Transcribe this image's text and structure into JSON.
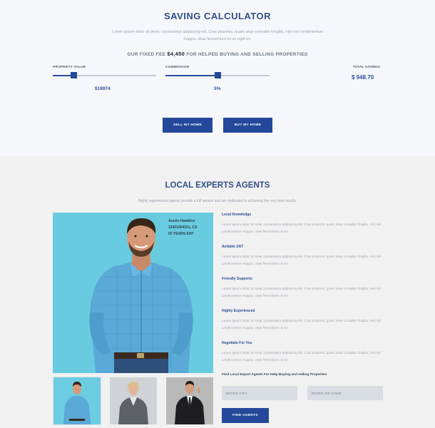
{
  "calculator": {
    "title": "SAVING CALCULATOR",
    "description": "Lorem ipsum dolor sit amet, consectetur adipiscing elit. Cras pharetra, quam vitae convallis fringilla, nisl nisl condimentum magna, vitae fermentum mi ex eget ex.",
    "fee_prefix": "OUR FIXED FEE",
    "fee_amount": "$4,450",
    "fee_suffix": "FOR HELPED BUYING AND SELLING PROPERTIES",
    "property_value": {
      "label": "PROPERTY VALUE",
      "value": "$18974",
      "level": 0.2
    },
    "commission": {
      "label": "COMMISSION",
      "value": "5%",
      "level": 0.5
    },
    "total_savings": {
      "label": "TOTAL SAVINGS",
      "value": "$ 948.70"
    },
    "sell_button": "SELL MY HOME",
    "buy_button": "BUY MY HOME"
  },
  "agents": {
    "title": "LOCAL EXPERTS AGENTS",
    "subtitle": "Highly experienced agents provide a full service and are dedicated to achieving the very best results.",
    "featured_agent": {
      "name": "Austin Hawkins",
      "phone": "12401004101, CA",
      "experience": "02 YEARS EXP"
    },
    "features": [
      {
        "title": "Local Knowledge",
        "text": "Lorem ipsum dolor sit amet, consectetur adipiscing elit. Cras pharetra, quam vitae convallis fringilla, nisl nisl condimentum magna, vitae fermentum mi ex."
      },
      {
        "title": "Avilable 24/7",
        "text": "Lorem ipsum dolor sit amet, consectetur adipiscing elit. Cras pharetra, quam vitae convallis fringilla, nisl nisl condimentum magna, vitae fermentum mi ex."
      },
      {
        "title": "Friendly Supports",
        "text": "Lorem ipsum dolor sit amet, consectetur adipiscing elit. Cras pharetra, quam vitae convallis fringilla, nisl nisl condimentum magna, vitae fermentum mi ex."
      },
      {
        "title": "Highly Experienced",
        "text": "Lorem ipsum dolor sit amet, consectetur adipiscing elit. Cras pharetra, quam vitae convallis fringilla, nisl nisl condimentum magna, vitae fermentum mi ex."
      },
      {
        "title": "Negotiate For You",
        "text": "Lorem ipsum dolor sit amet, consectetur adipiscing elit. Cras pharetra, quam vitae convallis fringilla, nisl nisl condimentum magna, vitae fermentum mi ex."
      }
    ],
    "find_label": "Find Local Expert Agents For Help Buying and selling Properties",
    "city_placeholder": "ENTER CITY",
    "zip_placeholder": "ENTER ZIP CODE",
    "find_button": "FIND AGENTS"
  },
  "colors": {
    "accent": "#24489a",
    "title": "#2f4f86",
    "photo_background": "#69cbe0"
  }
}
